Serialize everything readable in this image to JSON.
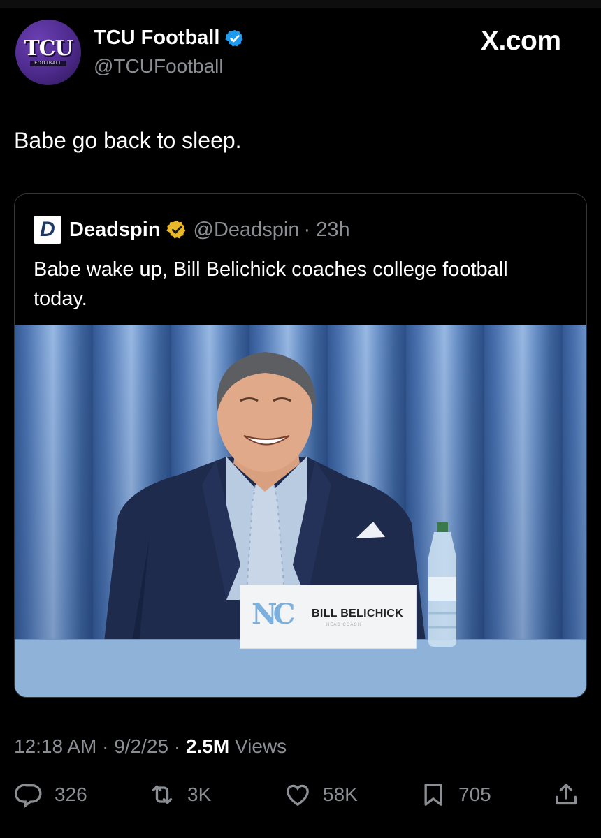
{
  "author": {
    "display_name": "TCU Football",
    "handle": "@TCUFootball",
    "avatar_text": "TCU",
    "avatar_subtext": "FOOTBALL"
  },
  "brand": "X.com",
  "tweet": {
    "text": "Babe go back to sleep."
  },
  "quoted": {
    "logo_letter": "D",
    "display_name": "Deadspin",
    "handle": "@Deadspin",
    "time": "· 23h",
    "text": "Babe wake up, Bill Belichick coaches college football today.",
    "image": {
      "nameplate_logo": "NC",
      "nameplate_name": "BILL BELICHICK",
      "nameplate_title": "HEAD COACH"
    }
  },
  "meta": {
    "time": "12:18 AM",
    "sep1": "·",
    "date": "9/2/25",
    "sep2": "·",
    "views_count": "2.5M",
    "views_label": "Views"
  },
  "actions": {
    "replies": "326",
    "reposts": "3K",
    "likes": "58K",
    "bookmarks": "705"
  },
  "colors": {
    "background": "#000000",
    "verified_blue": "#1d9bf0",
    "verified_gold": "#e8b829",
    "muted": "#8b8f94"
  },
  "icons": [
    "verified-badge-icon",
    "gold-verified-badge-icon",
    "reply-icon",
    "repost-icon",
    "like-icon",
    "bookmark-icon",
    "share-icon"
  ]
}
